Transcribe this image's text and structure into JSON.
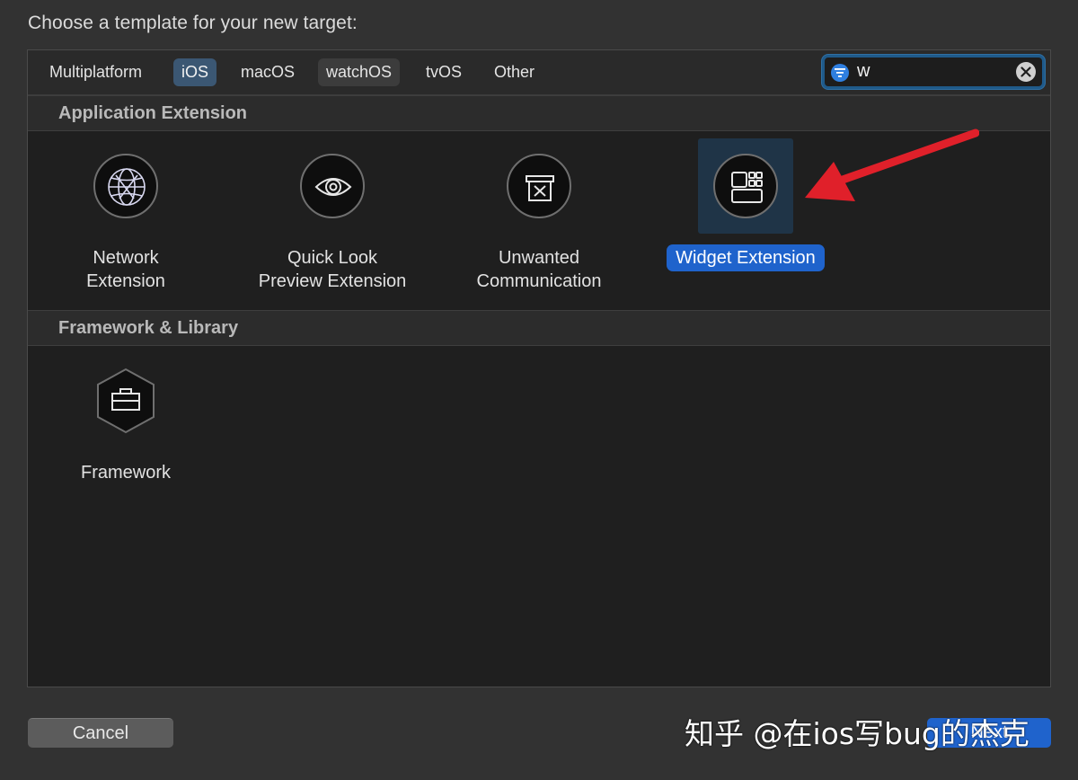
{
  "dialog": {
    "title": "Choose a template for your new target:"
  },
  "tabs": [
    {
      "label": "Multiplatform"
    },
    {
      "label": "iOS"
    },
    {
      "label": "macOS"
    },
    {
      "label": "watchOS"
    },
    {
      "label": "tvOS"
    },
    {
      "label": "Other"
    }
  ],
  "selected_tab": "iOS",
  "search": {
    "value": "w",
    "icon": "filter-icon",
    "clear_icon": "clear-icon"
  },
  "sections": [
    {
      "title": "Application Extension",
      "items": [
        {
          "label_line1": "Network",
          "label_line2": "Extension",
          "icon": "globe-network-icon"
        },
        {
          "label_line1": "Quick Look",
          "label_line2": "Preview Extension",
          "icon": "eye-icon"
        },
        {
          "label_line1": "Unwanted",
          "label_line2": "Communication",
          "icon": "trash-box-icon"
        },
        {
          "label_line1": "Widget Extension",
          "label_line2": "",
          "icon": "widget-grid-icon",
          "selected": true
        }
      ]
    },
    {
      "title": "Framework & Library",
      "items": [
        {
          "label_line1": "Framework",
          "label_line2": "",
          "icon": "toolbox-icon"
        }
      ]
    }
  ],
  "buttons": {
    "cancel": "Cancel",
    "next": "Next"
  },
  "watermark": "知乎 @在ios写bug的杰克",
  "colors": {
    "accent": "#1f63cc",
    "annotation_arrow": "#e0202a",
    "panel_bg": "#1f1f1f"
  }
}
